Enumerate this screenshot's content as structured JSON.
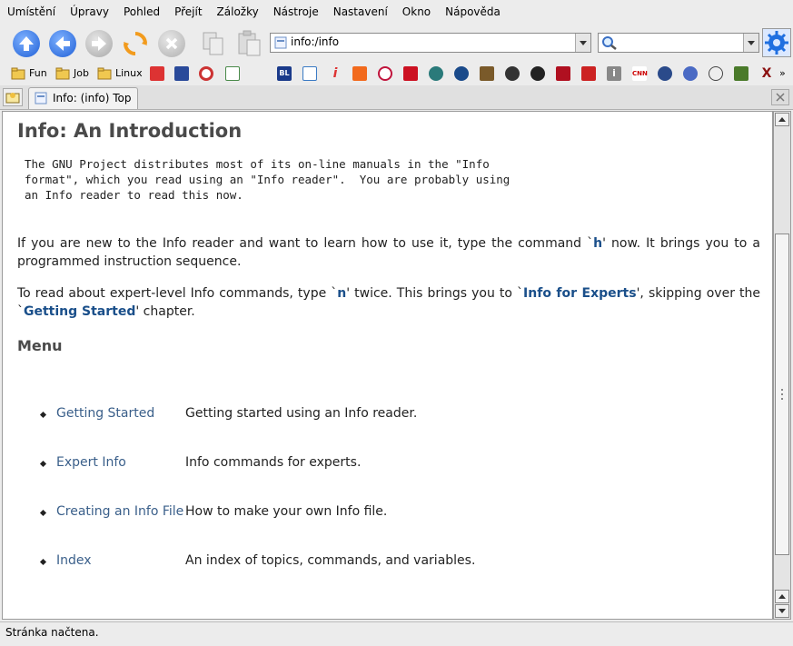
{
  "menubar": [
    "Umístění",
    "Úpravy",
    "Pohled",
    "Přejít",
    "Záložky",
    "Nástroje",
    "Nastavení",
    "Okno",
    "Nápověda"
  ],
  "toolbar": {
    "url": "info:/info",
    "search_value": ""
  },
  "bookmarks": {
    "folders": [
      "Fun",
      "Job",
      "Linux"
    ],
    "icons": [
      "BL",
      "G",
      "i",
      "CNN",
      "X"
    ]
  },
  "tab": {
    "title": "Info: (info) Top"
  },
  "page": {
    "title": "Info: An Introduction",
    "pre": "The GNU Project distributes most of its on-line manuals in the \"Info\nformat\", which you read using an \"Info reader\".  You are probably using\nan Info reader to read this now.",
    "p1_before": "If you are new to the Info reader and want to learn how to use it, type the command `",
    "p1_key": "h",
    "p1_after": "' now. It brings you to a programmed instruction sequence.",
    "p2_a": "To read about expert-level Info commands, type `",
    "p2_key": "n",
    "p2_b": "' twice. This brings you to `",
    "p2_link1": "Info for Experts",
    "p2_c": "', skipping over the `",
    "p2_link2": "Getting Started",
    "p2_d": "' chapter.",
    "menu_heading": "Menu",
    "menu": [
      {
        "link": "Getting Started",
        "desc": "Getting started using an Info reader."
      },
      {
        "link": "Expert Info",
        "desc": "Info commands for experts."
      },
      {
        "link": "Creating an Info File",
        "desc": "How to make your own Info file."
      },
      {
        "link": "Index",
        "desc": "An index of topics, commands, and variables."
      }
    ]
  },
  "status": "Stránka načtena."
}
